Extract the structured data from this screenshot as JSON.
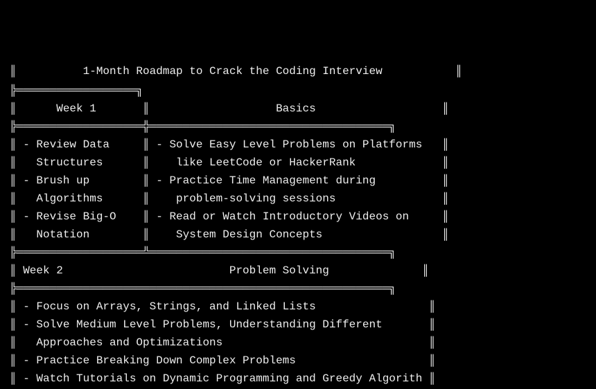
{
  "title": "1-Month Roadmap to Crack the Coding Interview",
  "week1": {
    "label": "Week 1",
    "heading": "Basics",
    "left_lines": [
      "- Review Data",
      "  Structures",
      "- Brush up",
      "  Algorithms",
      "- Revise Big-O",
      "  Notation"
    ],
    "right_lines": [
      "- Solve Easy Level Problems on Platforms",
      "   like LeetCode or HackerRank",
      "- Practice Time Management during",
      "   problem-solving sessions",
      "- Read or Watch Introductory Videos on",
      "   System Design Concepts"
    ]
  },
  "week2": {
    "label": "Week 2",
    "heading": "Problem Solving",
    "lines": [
      "- Focus on Arrays, Strings, and Linked Lists",
      "- Solve Medium Level Problems, Understanding Different",
      "  Approaches and Optimizations",
      "- Practice Breaking Down Complex Problems",
      "- Watch Tutorials on Dynamic Programming and Greedy Algorithms"
    ]
  }
}
